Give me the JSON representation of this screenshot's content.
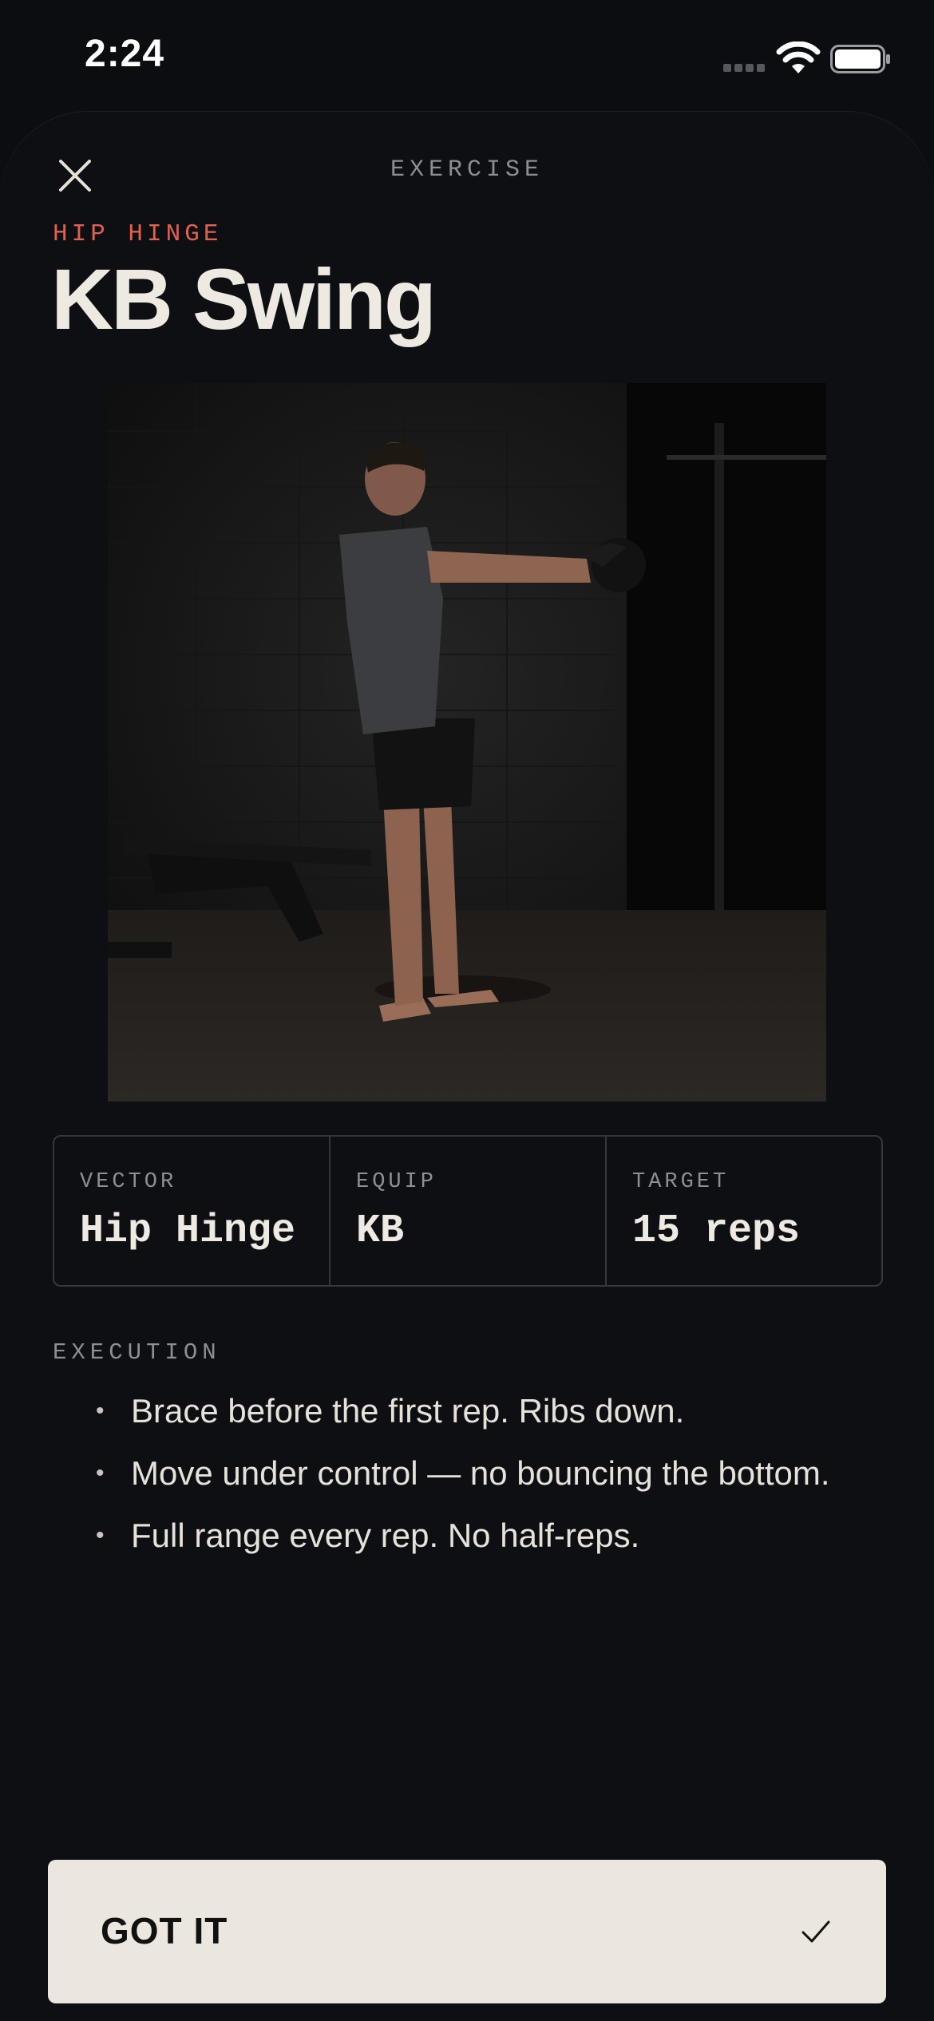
{
  "status_bar": {
    "time": "2:24"
  },
  "header": {
    "title": "EXERCISE",
    "close_icon": "close-icon"
  },
  "exercise": {
    "category": "HIP HINGE",
    "name": "KB Swing",
    "image_icon": "exercise-photo"
  },
  "stats": [
    {
      "label": "VECTOR",
      "value": "Hip Hinge"
    },
    {
      "label": "EQUIP",
      "value": "KB"
    },
    {
      "label": "TARGET",
      "value": "15 reps"
    }
  ],
  "execution": {
    "heading": "EXECUTION",
    "items": [
      "Brace before the first rep. Ribs down.",
      "Move under control — no bouncing the bottom.",
      "Full range every rep. No half-reps."
    ]
  },
  "cta": {
    "label": "GOT IT",
    "icon": "check-icon"
  },
  "colors": {
    "background": "#0b0d10",
    "accent": "#e2604e",
    "button_bg": "#ece7de"
  }
}
